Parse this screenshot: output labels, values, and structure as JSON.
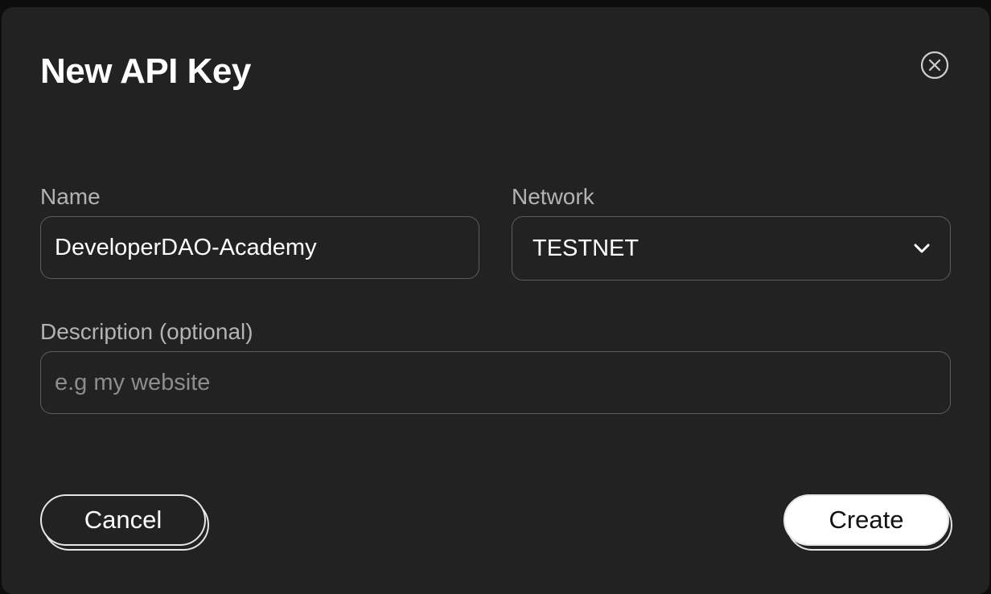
{
  "dialog": {
    "title": "New API Key",
    "close_icon": "close-circle-icon"
  },
  "form": {
    "name": {
      "label": "Name",
      "value": "DeveloperDAO-Academy"
    },
    "network": {
      "label": "Network",
      "selected": "TESTNET",
      "icon": "chevron-down-icon"
    },
    "description": {
      "label": "Description (optional)",
      "value": "",
      "placeholder": "e.g my website"
    }
  },
  "actions": {
    "cancel_label": "Cancel",
    "create_label": "Create"
  },
  "colors": {
    "dialog_background": "#222222",
    "input_border": "#5e5e5e",
    "label_text": "#b3b3b3",
    "placeholder_text": "#8d8d8d",
    "primary_button": "#ffffff"
  }
}
